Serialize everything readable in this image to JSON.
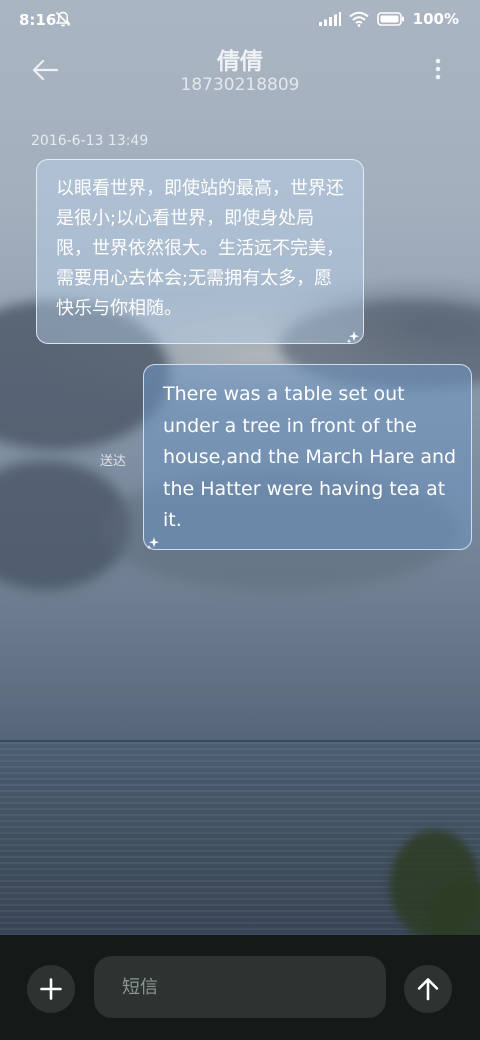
{
  "status_bar": {
    "time": "8:16",
    "battery": "100%",
    "icons": [
      "bell-off-icon",
      "signal-icon",
      "wifi-icon",
      "battery-icon"
    ]
  },
  "header": {
    "contact_name": "倩倩",
    "phone_number": "18730218809",
    "back_icon": "arrow-left-icon",
    "menu_icon": "more-vertical-icon"
  },
  "conversation": {
    "timestamp": "2016-6-13 13:49",
    "incoming": {
      "text": "以眼看世界，即使站的最高，世界还是很小;以心看世界，即使身处局限，世界依然很大。生活远不完美，需要用心去体会;无需拥有太多，愿快乐与你相随。"
    },
    "outgoing": {
      "text": "There was a table set out under a tree in front of the house,and the March Hare and the Hatter were having tea at it.",
      "status": "送达"
    }
  },
  "composer": {
    "placeholder": "短信",
    "value": "",
    "add_icon": "plus-icon",
    "send_icon": "arrow-up-icon"
  },
  "colors": {
    "bottom_bar": "#151a19",
    "control_bg": "#2c3331",
    "incoming_bubble": "rgba(190,215,240,0.42)",
    "outgoing_bubble": "rgba(110,150,195,0.55)"
  }
}
